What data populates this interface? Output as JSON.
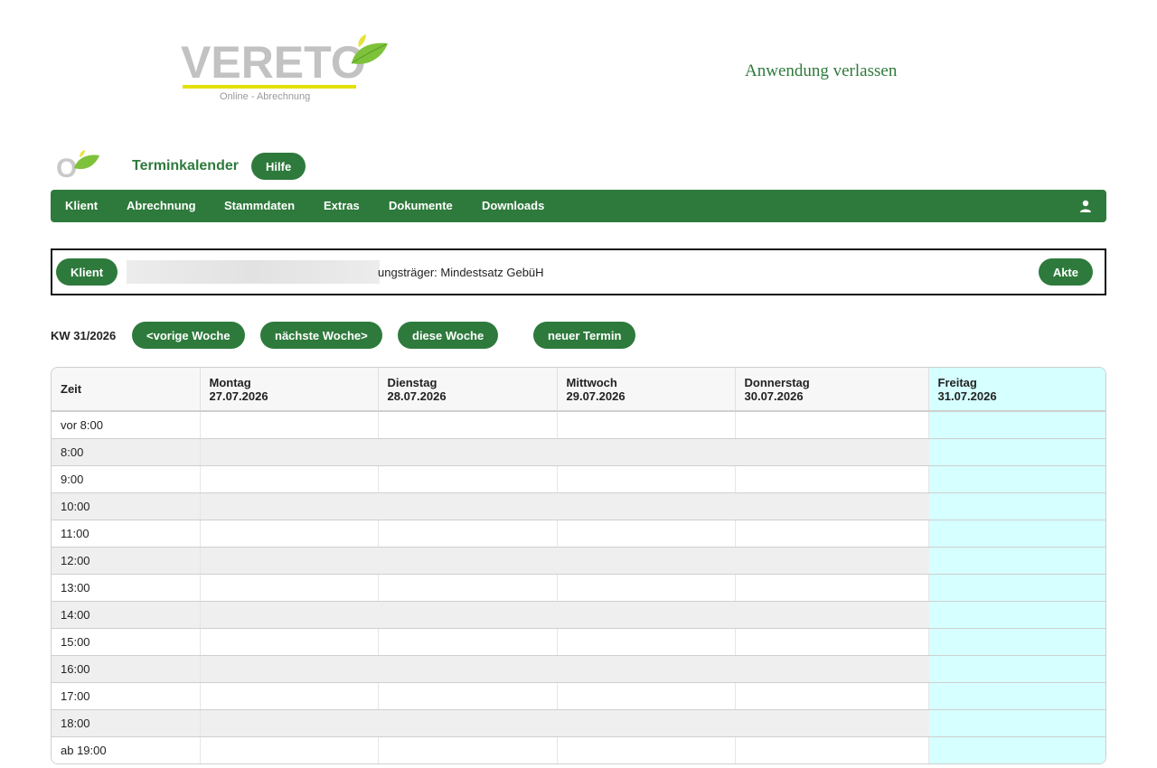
{
  "header": {
    "logo_name": "VERETO",
    "logo_sub": "Online - Abrechnung",
    "exit_label": "Anwendung verlassen",
    "small_logo_letter": "O"
  },
  "page": {
    "title": "Terminkalender",
    "help_label": "Hilfe"
  },
  "nav": {
    "items": [
      "Klient",
      "Abrechnung",
      "Stammdaten",
      "Extras",
      "Dokumente",
      "Downloads"
    ],
    "user_icon": "user-icon"
  },
  "client_bar": {
    "client_label": "Klient",
    "client_text": "ungsträger: Mindestsatz GebüH",
    "akte_label": "Akte"
  },
  "week": {
    "label": "KW 31/2026",
    "prev_label": "<vorige Woche",
    "next_label": "nächste Woche>",
    "this_label": "diese Woche",
    "new_label": "neuer Termin"
  },
  "calendar": {
    "time_header": "Zeit",
    "days": [
      {
        "name": "Montag",
        "date": "27.07.2026"
      },
      {
        "name": "Dienstag",
        "date": "28.07.2026"
      },
      {
        "name": "Mittwoch",
        "date": "29.07.2026"
      },
      {
        "name": "Donnerstag",
        "date": "30.07.2026"
      },
      {
        "name": "Freitag",
        "date": "31.07.2026"
      }
    ],
    "times": [
      "vor 8:00",
      "8:00",
      "9:00",
      "10:00",
      "11:00",
      "12:00",
      "13:00",
      "14:00",
      "15:00",
      "16:00",
      "17:00",
      "18:00",
      "ab 19:00"
    ]
  },
  "colors": {
    "brand_green": "#2e7a3c",
    "today_highlight": "#d6ffff",
    "logo_accent_yellow": "#e3e000"
  }
}
